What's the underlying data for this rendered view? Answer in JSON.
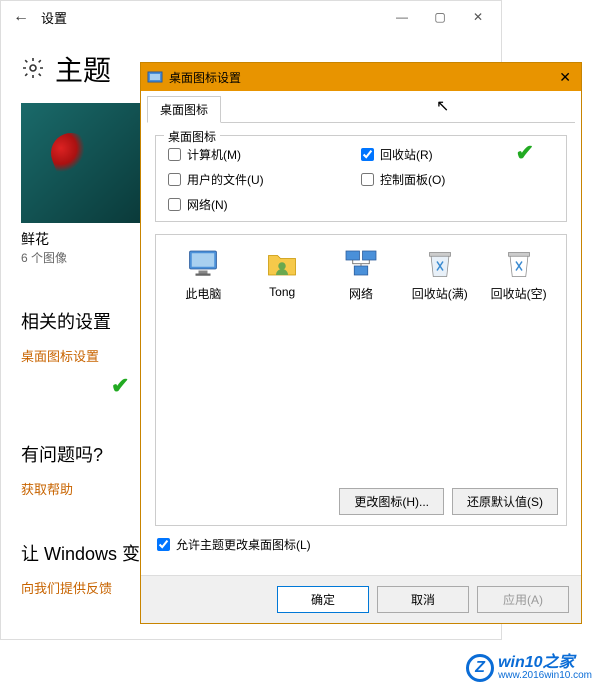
{
  "settings": {
    "title": "设置",
    "heading": "主题",
    "theme_name": "鲜花",
    "theme_count": "6 个图像",
    "related_heading": "相关的设置",
    "desktop_icons_link": "桌面图标设置",
    "question_heading": "有问题吗?",
    "get_help": "获取帮助",
    "improve_heading": "让 Windows 变",
    "feedback_link": "向我们提供反馈"
  },
  "dialog": {
    "title": "桌面图标设置",
    "tab": "桌面图标",
    "group_label": "桌面图标",
    "checks": {
      "computer": "计算机(M)",
      "userfiles": "用户的文件(U)",
      "network": "网络(N)",
      "recycle": "回收站(R)",
      "control": "控制面板(O)"
    },
    "values": {
      "computer": false,
      "userfiles": false,
      "network": false,
      "recycle": true,
      "control": false,
      "allow_theme": true
    },
    "icons": {
      "pc": "此电脑",
      "tong": "Tong",
      "net": "网络",
      "bin_full": "回收站(满)",
      "bin_empty": "回收站(空)"
    },
    "change_icon": "更改图标(H)...",
    "restore_default": "还原默认值(S)",
    "allow_theme": "允许主题更改桌面图标(L)",
    "ok": "确定",
    "cancel": "取消",
    "apply": "应用(A)"
  },
  "watermark": {
    "brand": "win10之家",
    "url": "www.2016win10.com"
  }
}
